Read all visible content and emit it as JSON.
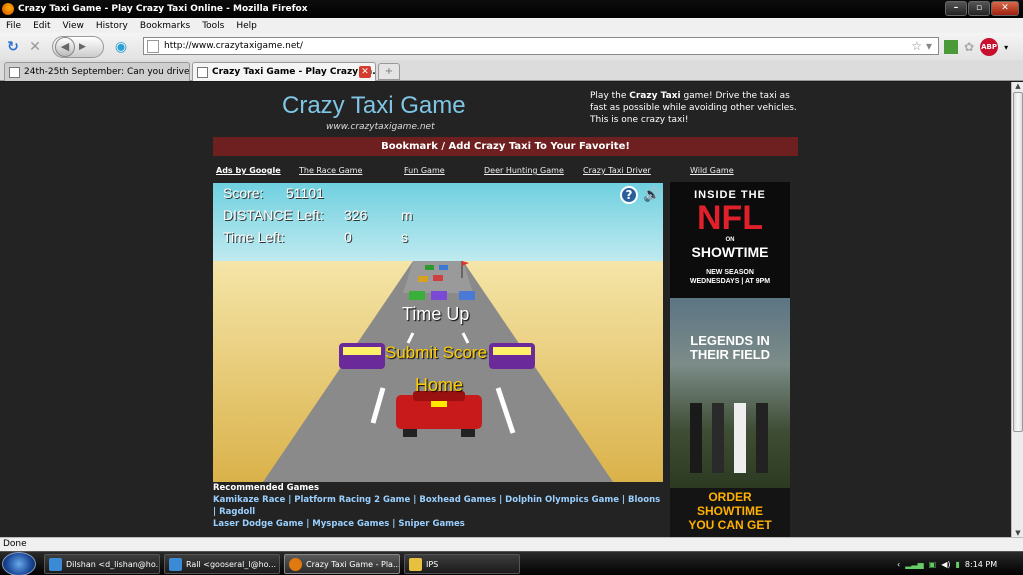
{
  "window": {
    "title": "Crazy Taxi Game - Play Crazy Taxi Online - Mozilla Firefox"
  },
  "menu": [
    "File",
    "Edit",
    "View",
    "History",
    "Bookmarks",
    "Tools",
    "Help"
  ],
  "address": {
    "url": "http://www.crazytaxigame.net/"
  },
  "tabs": [
    {
      "label": "24th-25th September: Can you drive a ..."
    },
    {
      "label": "Crazy Taxi Game - Play Crazy Ta..."
    }
  ],
  "page": {
    "title": "Crazy Taxi Game",
    "url": "www.crazytaxigame.net",
    "desc_pre": "Play the ",
    "desc_bold": "Crazy Taxi",
    "desc_post": " game! Drive the taxi as fast as possible while avoiding other vehicles. This is one crazy taxi!",
    "bookmark": "Bookmark / Add Crazy Taxi To Your Favorite!",
    "ads_by_google": "Ads by Google",
    "ad_links": [
      "The Race Game",
      "Fun Game",
      "Deer Hunting Game",
      "Crazy Taxi Driver",
      "Wild Game"
    ]
  },
  "game": {
    "score_label": "Score:",
    "score_value": "51101",
    "distance_label": "DISTANCE Left:",
    "distance_value": "326",
    "distance_unit": "m",
    "time_label": "Time Left:",
    "time_value": "0",
    "time_unit": "s",
    "time_up": "Time Up",
    "submit": "Submit Score",
    "home": "Home",
    "help_icon": "?"
  },
  "ad": {
    "line1": "INSIDE THE",
    "nfl": "NFL",
    "on": "ON",
    "showtime": "SHOWTIME",
    "season": "NEW SEASON",
    "schedule": "WEDNESDAYS | AT 9PM",
    "legends": "LEGENDS IN THEIR FIELD",
    "order": "ORDER",
    "order_show": "SHOWTIME",
    "order_get": "YOU CAN GET"
  },
  "recommended": {
    "title": "Recommended Games",
    "games": [
      "Kamikaze Race",
      "Platform Racing 2 Game",
      "Boxhead Games",
      "Dolphin Olympics Game",
      "Bloons",
      "Ragdoll",
      "Laser Dodge Game",
      "Myspace Games",
      "Sniper Games"
    ]
  },
  "status": "Done",
  "taskbar": {
    "items": [
      "Dilshan <d_lishan@ho...",
      "Rall <gooseral_l@ho...",
      "Crazy Taxi Game - Pla...",
      "IPS"
    ],
    "clock": "8:14 PM"
  },
  "colors": {
    "title": "#7fc6e6",
    "bookmark_bg": "#6e1f1f",
    "link": "#9ad0ff",
    "game_text": "#ffcc00"
  }
}
